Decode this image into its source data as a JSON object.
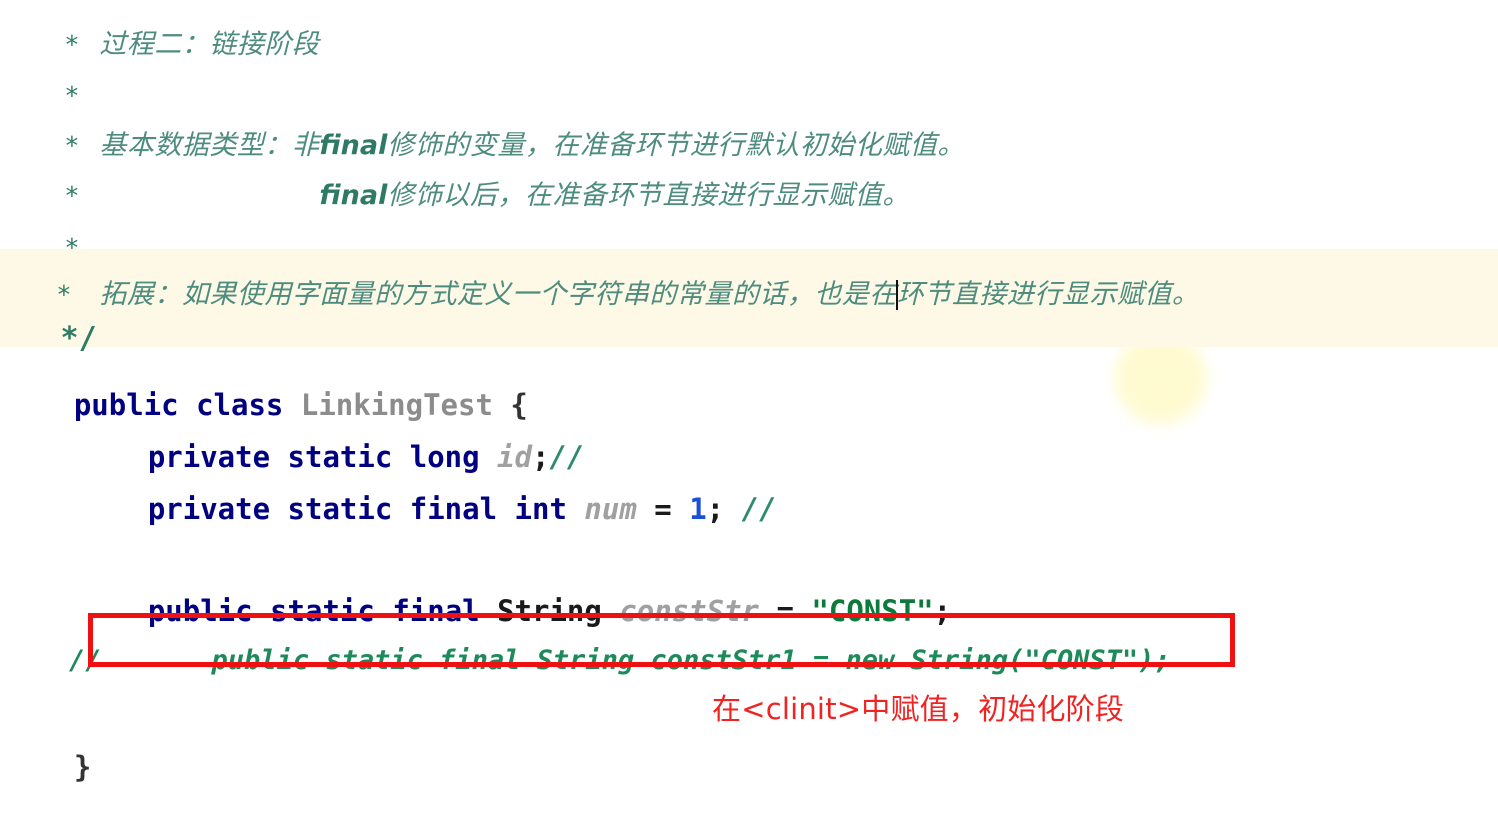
{
  "editor": {
    "language": "java",
    "colors": {
      "comment_green": "#3f8272",
      "keyword_navy": "#000080",
      "class_gray": "#8c8c8c",
      "field_gray": "#a0a0a0",
      "string_green": "#0b7a3b",
      "number_blue": "#1a4fd6",
      "annotation_red": "#ef1111",
      "caret_line_bg": "#fdf9e6",
      "highlight_blob": "#fffacd"
    }
  },
  "block_comment": {
    "line1": {
      "star": "*",
      "text": "过程二：链接阶段"
    },
    "line2": {
      "star": "*",
      "text": ""
    },
    "line3": {
      "star": "*",
      "prefix": "基本数据类型：非",
      "keyword": "final",
      "suffix": "修饰的变量，在准备环节进行默认初始化赋值。"
    },
    "line4": {
      "star": "*",
      "indent": "        ",
      "keyword": "final",
      "suffix": "修饰以后，在准备环节直接进行显示赋值。"
    },
    "line5": {
      "star": "*",
      "text": ""
    },
    "line6": {
      "star": "*",
      "text": ""
    },
    "line7": {
      "star": "*",
      "prefix": "拓展：如果使用字面量的方式定义一个字符串的常量的话，也是在",
      "suffix": "环节直接进行显示赋值。"
    },
    "end": "*/"
  },
  "code": {
    "class_decl": {
      "kw_public": "public",
      "kw_class": "class",
      "class_name": "LinkingTest",
      "brace": "{"
    },
    "field_id": {
      "kw_private": "private",
      "kw_static": "static",
      "type": "long",
      "name": "id",
      "semi": ";",
      "comment": "//"
    },
    "field_num": {
      "kw_private": "private",
      "kw_static": "static",
      "kw_final": "final",
      "type": "int",
      "name": "num",
      "eq": "=",
      "value": "1",
      "semi": ";",
      "comment": "//"
    },
    "field_conststr": {
      "kw_public": "public",
      "kw_static": "static",
      "kw_final": "final",
      "type": "String",
      "name": "constStr",
      "eq": "=",
      "value": "\"CONST\"",
      "semi": ";"
    },
    "commented_line": {
      "slashes": "//",
      "text": "public static final String constStr1 = new String(\"CONST\");"
    },
    "closing_brace": "}"
  },
  "annotations": {
    "red_note": "在<clinit>中赋值，初始化阶段"
  }
}
